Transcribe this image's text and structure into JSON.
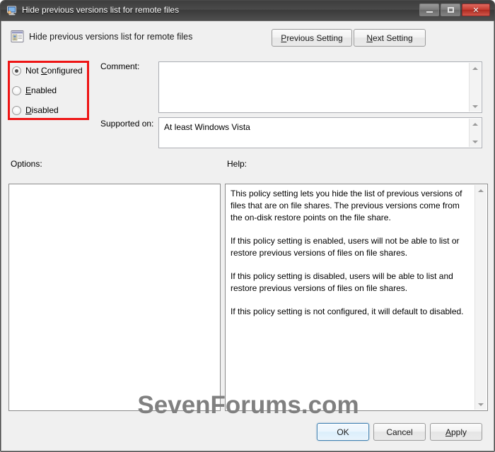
{
  "window": {
    "title": "Hide previous versions list for remote files",
    "icon": "policy-monitor-icon",
    "caption_buttons": {
      "minimize_label": "Minimize",
      "maximize_label": "Maximize",
      "close_label": "✕"
    }
  },
  "header": {
    "icon": "policy-setting-icon",
    "title": "Hide previous versions list for remote files",
    "previous_setting": {
      "accel": "P",
      "rest": "revious Setting"
    },
    "next_setting": {
      "accel": "N",
      "rest": "ext Setting"
    }
  },
  "state_options": {
    "selected": "Not Configured",
    "items": [
      {
        "pre": "Not ",
        "accel": "C",
        "post": "onfigured",
        "checked": true
      },
      {
        "pre": "",
        "accel": "E",
        "post": "nabled",
        "checked": false
      },
      {
        "pre": "",
        "accel": "D",
        "post": "isabled",
        "checked": false
      }
    ],
    "highlight_color": "#ee1414"
  },
  "fields": {
    "comment_label": "Comment:",
    "comment_value": "",
    "comment_placeholder": "",
    "supported_label": "Supported on:",
    "supported_value": "At least Windows Vista"
  },
  "panels": {
    "options_label": "Options:",
    "options_content": "",
    "help_label": "Help:",
    "help_paragraphs": [
      "This policy setting lets you hide the list of previous versions of files that are on file shares. The previous versions come from the on-disk restore points on the file share.",
      "If this policy setting is enabled, users will not be able to list or restore previous versions of files on file shares.",
      "If this policy setting is disabled, users will be able to list and restore previous versions of files on file shares.",
      "If this policy setting is not configured, it will default to disabled."
    ]
  },
  "watermark": {
    "text": "SevenForums.com",
    "color": "#808080"
  },
  "footer": {
    "ok_label": "OK",
    "cancel_label": "Cancel",
    "apply": {
      "accel": "A",
      "rest": "pply"
    }
  }
}
